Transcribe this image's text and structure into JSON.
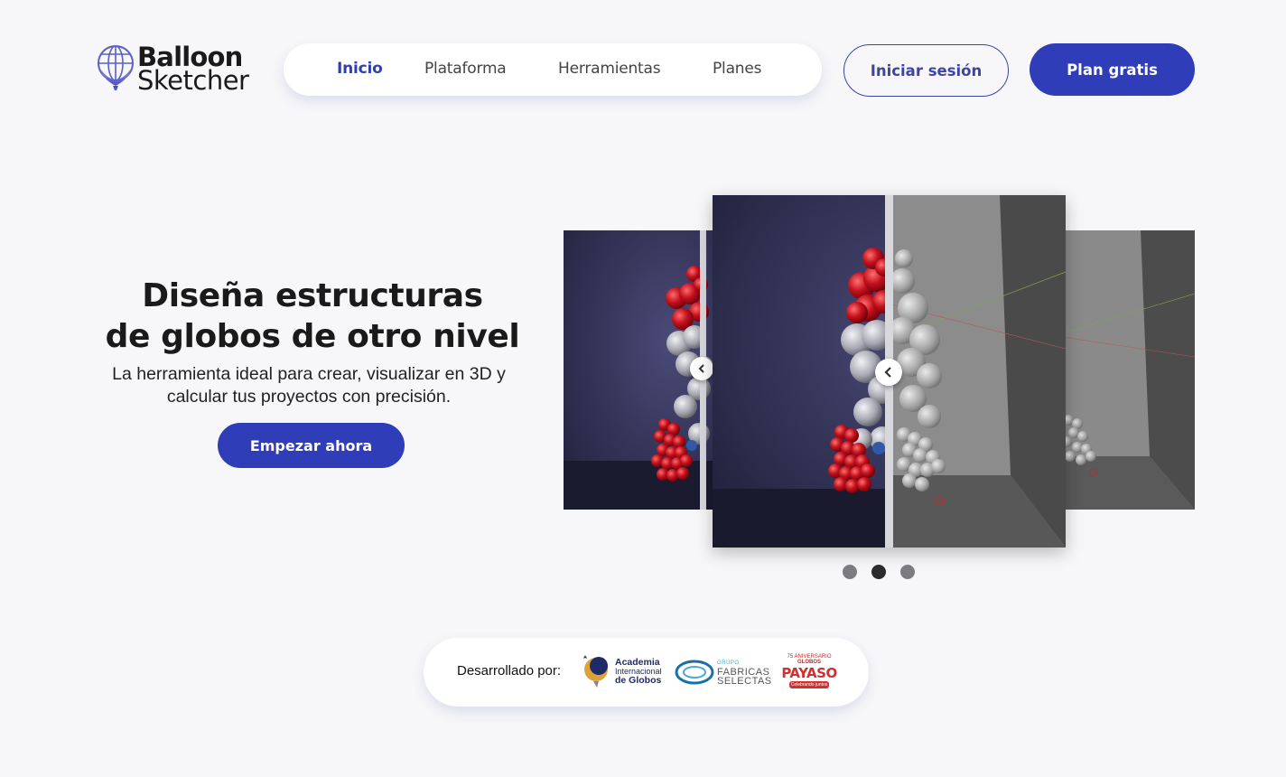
{
  "brand": {
    "name_line1": "Balloon",
    "name_line2": "Sketcher",
    "accent_color": "#2f3db8",
    "logo_icon": "balloon-globe-icon"
  },
  "nav": {
    "items": [
      {
        "label": "Inicio",
        "active": true
      },
      {
        "label": "Plataforma",
        "active": false
      },
      {
        "label": "Herramientas",
        "active": false
      },
      {
        "label": "Planes",
        "active": false
      }
    ]
  },
  "header_actions": {
    "login_label": "Iniciar sesión",
    "plan_label": "Plan gratis"
  },
  "hero": {
    "title_bold_1": "Diseña",
    "title_regular_1": " estructuras",
    "title_regular_2": "de globos de otro ",
    "title_bold_2": "nivel",
    "subtitle": "La herramienta ideal para crear, visualizar en 3D y calcular tus proyectos con precisión.",
    "cta_label": "Empezar ahora"
  },
  "carousel": {
    "slide_count": 3,
    "active_index": 1,
    "handle_icon": "chevron-left-icon"
  },
  "partners": {
    "label": "Desarrollado por:",
    "academia": {
      "line1": "Academia",
      "line2": "Internacional",
      "line3": "de Globos"
    },
    "fabricas": {
      "small": "GRUPO",
      "line1": "FABRICAS",
      "line2": "SELECTAS"
    },
    "payaso": {
      "top": "75 ANIVERSARIO",
      "main": "PAYASO",
      "small": "GLOBOS",
      "bottom": "Celebrando juntos"
    }
  }
}
